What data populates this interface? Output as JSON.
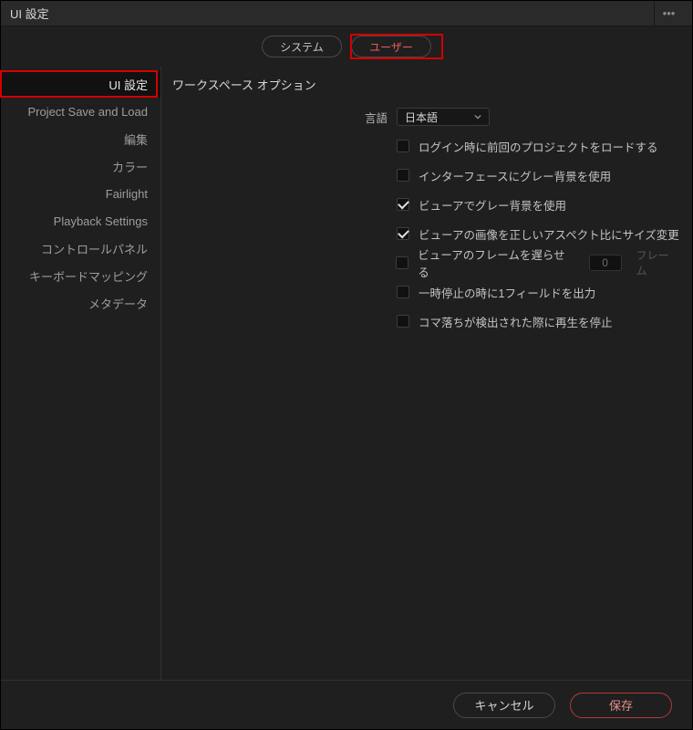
{
  "window": {
    "title": "UI 設定"
  },
  "tabs": {
    "system": "システム",
    "user": "ユーザー"
  },
  "sidebar": {
    "items": [
      {
        "label": "UI 設定"
      },
      {
        "label": "Project Save and Load"
      },
      {
        "label": "編集"
      },
      {
        "label": "カラー"
      },
      {
        "label": "Fairlight"
      },
      {
        "label": "Playback Settings"
      },
      {
        "label": "コントロールパネル"
      },
      {
        "label": "キーボードマッピング"
      },
      {
        "label": "メタデータ"
      }
    ]
  },
  "panel": {
    "section": "ワークスペース オプション",
    "language_label": "言語",
    "language_value": "日本語",
    "opts": {
      "load_last": "ログイン時に前回のプロジェクトをロードする",
      "gray_ui": "インターフェースにグレー背景を使用",
      "viewer_gray": "ビューアでグレー背景を使用",
      "viewer_aspect": "ビューアの画像を正しいアスペクト比にサイズ変更",
      "delay_label": "ビューアのフレームを遅らせる",
      "delay_value": "0",
      "delay_unit": "フレーム",
      "pause_field": "一時停止の時に1フィールドを出力",
      "drop_stop": "コマ落ちが検出された際に再生を停止"
    }
  },
  "footer": {
    "cancel": "キャンセル",
    "save": "保存"
  }
}
